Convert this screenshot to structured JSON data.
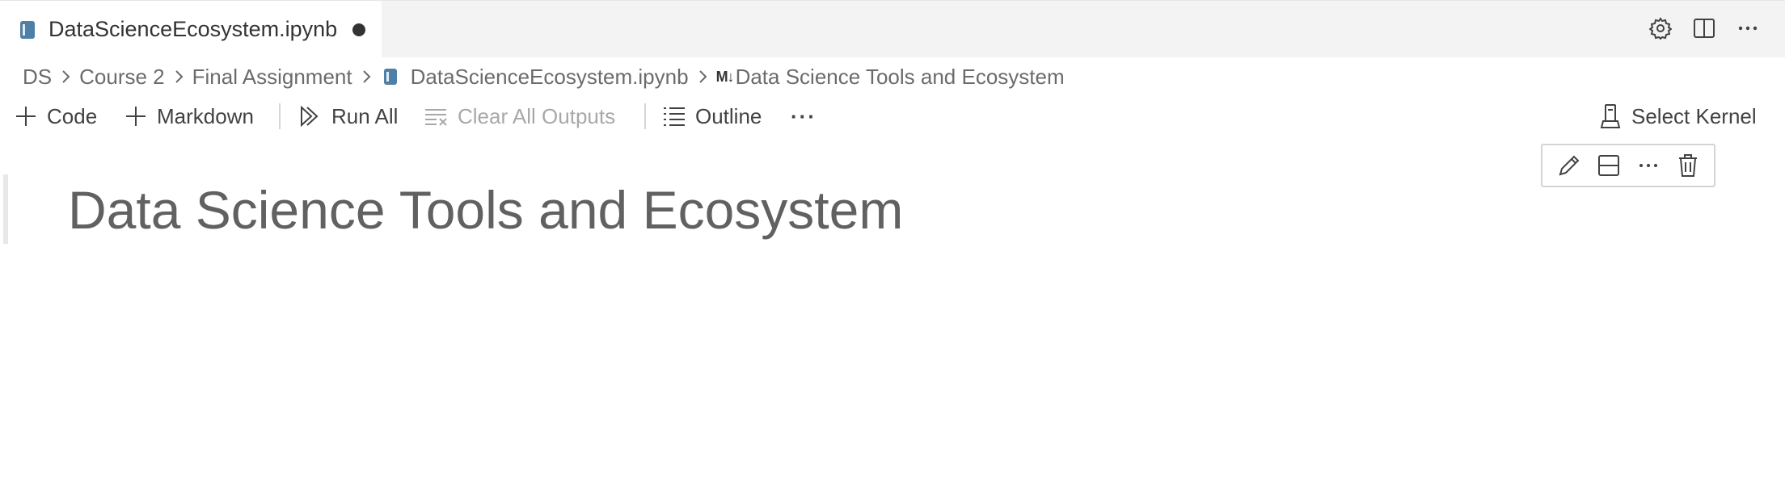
{
  "tab": {
    "label": "DataScienceEcosystem.ipynb",
    "dirty": true
  },
  "tab_actions": [
    "gear-icon",
    "split-editor-icon",
    "more-icon"
  ],
  "breadcrumb": {
    "items": [
      "DS",
      "Course 2",
      "Final Assignment",
      "DataScienceEcosystem.ipynb"
    ],
    "md_badge": "M↓",
    "current": "Data Science Tools and Ecosystem"
  },
  "toolbar": {
    "code_label": "Code",
    "markdown_label": "Markdown",
    "run_all_label": "Run All",
    "clear_outputs_label": "Clear All Outputs",
    "outline_label": "Outline",
    "more_label": "···",
    "kernel_label": "Select Kernel"
  },
  "cell_toolbar": [
    "pencil-icon",
    "split-cell-icon",
    "more-icon",
    "trash-icon"
  ],
  "cell": {
    "heading": "Data Science Tools and Ecosystem"
  },
  "colors": {
    "notebook_icon": "#4e7fa6",
    "tab_bg": "#f3f3f3",
    "heading": "#616161"
  }
}
